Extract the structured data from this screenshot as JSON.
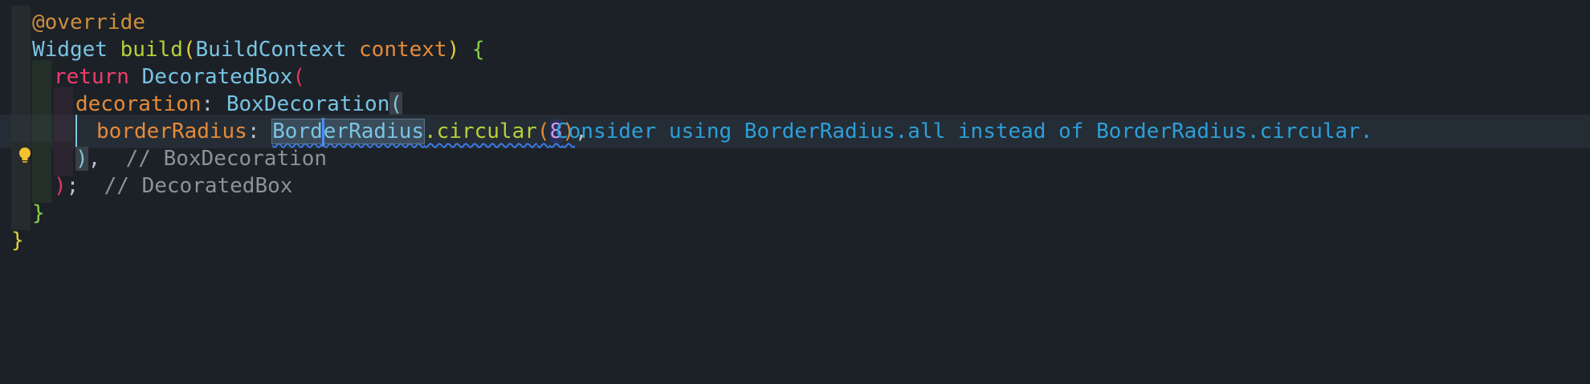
{
  "editor": {
    "line1": {
      "annotation": "@override"
    },
    "line2": {
      "type": "Widget",
      "method": "build",
      "open": "(",
      "param_type": "BuildContext",
      "param_name": "context",
      "close": ")",
      "brace": "{"
    },
    "line3": {
      "keyword": "return",
      "type": "DecoratedBox",
      "open": "("
    },
    "line4": {
      "param": "decoration",
      "colon": ":",
      "type": "BoxDecoration",
      "open": "("
    },
    "line5": {
      "param": "borderRadius",
      "colon": ":",
      "type_a": "Bord",
      "type_b": "erRadius",
      "method": ".circular",
      "open": "(",
      "number": "8",
      "close": ")",
      "comma": ",",
      "hint": "Consider using BorderRadius.all instead of BorderRadius.circular."
    },
    "line6": {
      "close": ")",
      "comma": ",",
      "comment": "// BoxDecoration"
    },
    "line7": {
      "close": ")",
      "semi": ";",
      "comment": "// DecoratedBox"
    },
    "line8": {
      "brace": "}"
    },
    "line9": {
      "brace": "}"
    }
  },
  "icons": {
    "lightbulb": "lightbulb-icon"
  },
  "colors": {
    "background": "#1c2127",
    "current_line": "#242c35",
    "hint": "#2d9fd8",
    "keyword": "#ee3d6e",
    "type": "#79c4e3"
  }
}
